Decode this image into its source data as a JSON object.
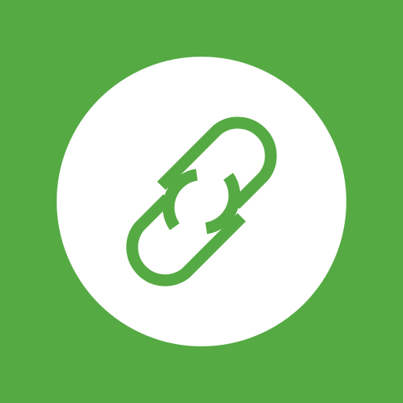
{
  "icon": {
    "name": "link-icon",
    "background_color": "#55aa44",
    "badge_color": "#ffffff",
    "glyph_color": "#55aa44"
  }
}
